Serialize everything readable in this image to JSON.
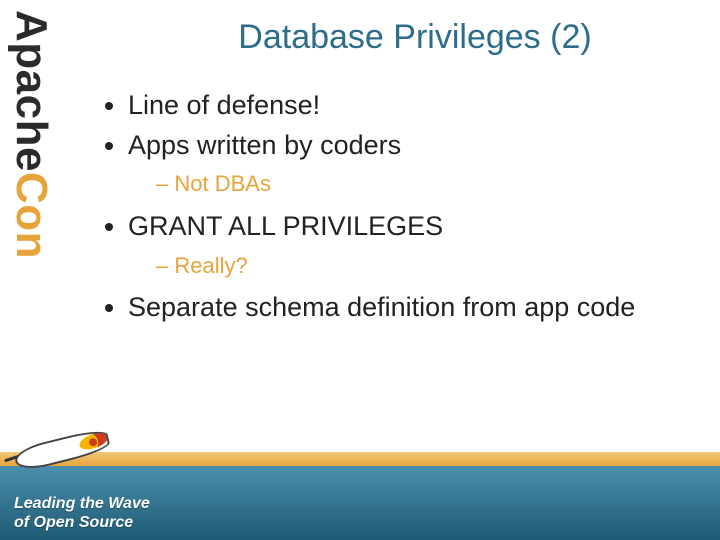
{
  "brand": {
    "name_part1": "Apache",
    "name_part2": "Con"
  },
  "title": "Database Privileges (2)",
  "bullets": [
    {
      "text": "Line of defense!",
      "sub": []
    },
    {
      "text": "Apps written by coders",
      "sub": [
        "Not DBAs"
      ]
    },
    {
      "text": "GRANT ALL PRIVILEGES",
      "sub": [
        "Really?"
      ]
    },
    {
      "text": "Separate schema definition from app code",
      "sub": []
    }
  ],
  "footer": {
    "line1": "Leading the Wave",
    "line2": "of Open Source"
  },
  "colors": {
    "title": "#2e6d8a",
    "sub_bullet": "#e7a33a",
    "footer_gradient_top": "#4a8fad",
    "footer_gradient_bottom": "#1f5a74",
    "band_gradient_top": "#f2c97a",
    "band_gradient_bottom": "#e7a33a"
  }
}
